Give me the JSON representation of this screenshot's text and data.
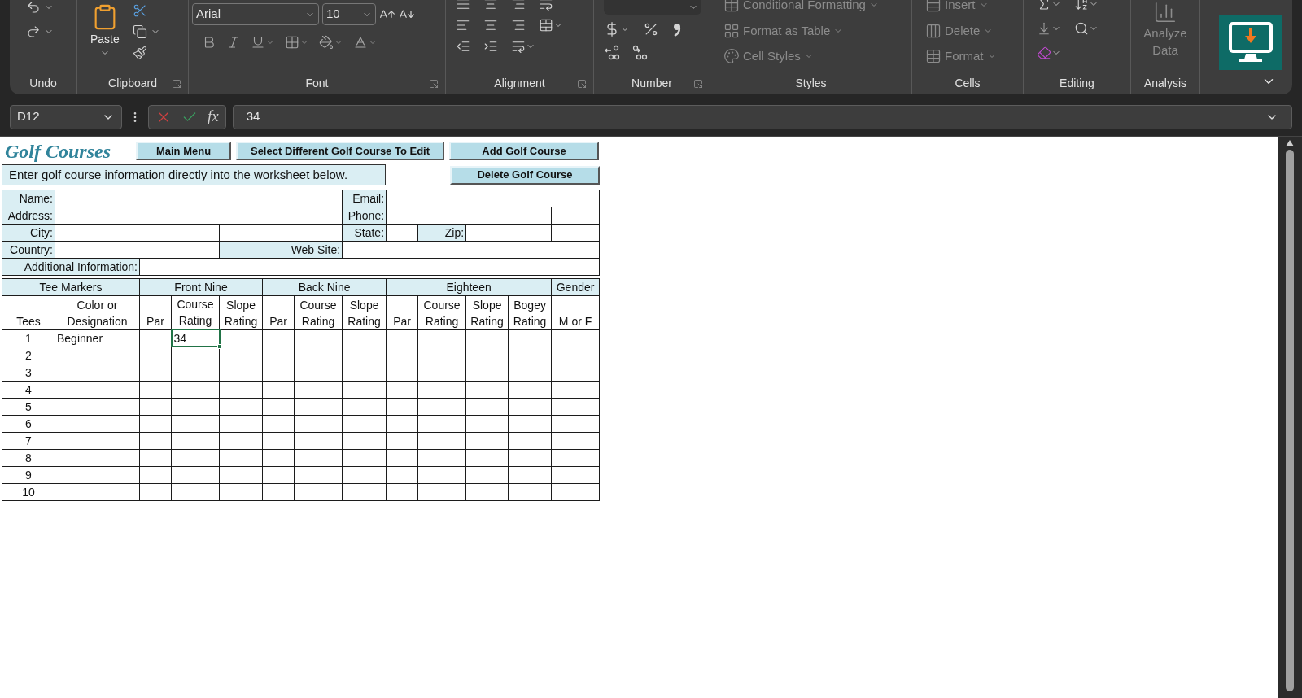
{
  "ribbon": {
    "groups": [
      {
        "kind": "undo",
        "label": "Undo"
      },
      {
        "kind": "clipboard",
        "label": "Clipboard",
        "paste": "Paste"
      },
      {
        "kind": "font",
        "label": "Font",
        "font_name": "Arial",
        "font_size": "10"
      },
      {
        "kind": "alignment",
        "label": "Alignment"
      },
      {
        "kind": "number",
        "label": "Number"
      },
      {
        "kind": "styles",
        "label": "Styles",
        "commands": [
          {
            "label": "Conditional Formatting",
            "disabled": true
          },
          {
            "label": "Format as Table",
            "disabled": true
          },
          {
            "label": "Cell Styles",
            "disabled": true
          }
        ]
      },
      {
        "kind": "cells",
        "label": "Cells",
        "commands": [
          {
            "label": "Insert",
            "disabled": true
          },
          {
            "label": "Delete",
            "disabled": true
          },
          {
            "label": "Format",
            "disabled": true
          }
        ]
      },
      {
        "kind": "editing",
        "label": "Editing"
      },
      {
        "kind": "analysis",
        "label": "Analysis",
        "commands": [
          {
            "label": "Analyze Data",
            "disabled": true
          }
        ]
      }
    ]
  },
  "formula_bar": {
    "name_box": "D12",
    "function_label": "fx",
    "value": "34"
  },
  "sheet": {
    "title": "Golf Courses",
    "buttons": [
      {
        "label": "Main Menu"
      },
      {
        "label": "Select Different Golf Course To Edit"
      },
      {
        "label": "Add Golf Course"
      },
      {
        "label": "Delete Golf Course"
      }
    ],
    "instruction": "Enter golf course information directly into the worksheet below.",
    "info_rows": [
      {
        "labels": [
          "Name:",
          "Email:"
        ]
      },
      {
        "labels": [
          "Address:",
          "Phone:"
        ]
      },
      {
        "labels": [
          "City:",
          "State:",
          "Zip:"
        ]
      },
      {
        "labels": [
          "Country:",
          "Web Site:"
        ]
      },
      {
        "labels": [
          "Additional Information:"
        ]
      }
    ],
    "column_groups": [
      "Tee Markers",
      "Front Nine",
      "Back Nine",
      "Eighteen",
      "Gender"
    ],
    "columns": [
      "Tees",
      "Color or Designation",
      "Par",
      "Course Rating",
      "Slope Rating",
      "Par",
      "Course Rating",
      "Slope Rating",
      "Par",
      "Course Rating",
      "Slope Rating",
      "Bogey Rating",
      "M or F"
    ],
    "rows": [
      {
        "cells": [
          {
            "text": "1",
            "selected": false
          },
          {
            "text": "Beginner",
            "selected": false
          },
          {
            "selected": false
          },
          {
            "text": "34",
            "selected": true
          },
          {
            "selected": false
          },
          {
            "selected": false
          },
          {
            "selected": false
          },
          {
            "selected": false
          },
          {
            "selected": false
          },
          {
            "selected": false
          },
          {
            "selected": false
          },
          {
            "selected": false
          },
          {
            "selected": false
          }
        ]
      },
      {
        "cells": [
          {
            "text": "2",
            "selected": false
          },
          {
            "selected": false
          },
          {
            "selected": false
          },
          {
            "selected": false
          },
          {
            "selected": false
          },
          {
            "selected": false
          },
          {
            "selected": false
          },
          {
            "selected": false
          },
          {
            "selected": false
          },
          {
            "selected": false
          },
          {
            "selected": false
          },
          {
            "selected": false
          },
          {
            "selected": false
          }
        ]
      },
      {
        "cells": [
          {
            "text": "3",
            "selected": false
          },
          {
            "selected": false
          },
          {
            "selected": false
          },
          {
            "selected": false
          },
          {
            "selected": false
          },
          {
            "selected": false
          },
          {
            "selected": false
          },
          {
            "selected": false
          },
          {
            "selected": false
          },
          {
            "selected": false
          },
          {
            "selected": false
          },
          {
            "selected": false
          },
          {
            "selected": false
          }
        ]
      },
      {
        "cells": [
          {
            "text": "4",
            "selected": false
          },
          {
            "selected": false
          },
          {
            "selected": false
          },
          {
            "selected": false
          },
          {
            "selected": false
          },
          {
            "selected": false
          },
          {
            "selected": false
          },
          {
            "selected": false
          },
          {
            "selected": false
          },
          {
            "selected": false
          },
          {
            "selected": false
          },
          {
            "selected": false
          },
          {
            "selected": false
          }
        ]
      },
      {
        "cells": [
          {
            "text": "5",
            "selected": false
          },
          {
            "selected": false
          },
          {
            "selected": false
          },
          {
            "selected": false
          },
          {
            "selected": false
          },
          {
            "selected": false
          },
          {
            "selected": false
          },
          {
            "selected": false
          },
          {
            "selected": false
          },
          {
            "selected": false
          },
          {
            "selected": false
          },
          {
            "selected": false
          },
          {
            "selected": false
          }
        ]
      },
      {
        "cells": [
          {
            "text": "6",
            "selected": false
          },
          {
            "selected": false
          },
          {
            "selected": false
          },
          {
            "selected": false
          },
          {
            "selected": false
          },
          {
            "selected": false
          },
          {
            "selected": false
          },
          {
            "selected": false
          },
          {
            "selected": false
          },
          {
            "selected": false
          },
          {
            "selected": false
          },
          {
            "selected": false
          },
          {
            "selected": false
          }
        ]
      },
      {
        "cells": [
          {
            "text": "7",
            "selected": false
          },
          {
            "selected": false
          },
          {
            "selected": false
          },
          {
            "selected": false
          },
          {
            "selected": false
          },
          {
            "selected": false
          },
          {
            "selected": false
          },
          {
            "selected": false
          },
          {
            "selected": false
          },
          {
            "selected": false
          },
          {
            "selected": false
          },
          {
            "selected": false
          },
          {
            "selected": false
          }
        ]
      },
      {
        "cells": [
          {
            "text": "8",
            "selected": false
          },
          {
            "selected": false
          },
          {
            "selected": false
          },
          {
            "selected": false
          },
          {
            "selected": false
          },
          {
            "selected": false
          },
          {
            "selected": false
          },
          {
            "selected": false
          },
          {
            "selected": false
          },
          {
            "selected": false
          },
          {
            "selected": false
          },
          {
            "selected": false
          },
          {
            "selected": false
          }
        ]
      },
      {
        "cells": [
          {
            "text": "9",
            "selected": false
          },
          {
            "selected": false
          },
          {
            "selected": false
          },
          {
            "selected": false
          },
          {
            "selected": false
          },
          {
            "selected": false
          },
          {
            "selected": false
          },
          {
            "selected": false
          },
          {
            "selected": false
          },
          {
            "selected": false
          },
          {
            "selected": false
          },
          {
            "selected": false
          },
          {
            "selected": false
          }
        ]
      },
      {
        "cells": [
          {
            "text": "10",
            "selected": false
          },
          {
            "selected": false
          },
          {
            "selected": false
          },
          {
            "selected": false
          },
          {
            "selected": false
          },
          {
            "selected": false
          },
          {
            "selected": false
          },
          {
            "selected": false
          },
          {
            "selected": false
          },
          {
            "selected": false
          },
          {
            "selected": false
          },
          {
            "selected": false
          },
          {
            "selected": false
          }
        ]
      }
    ]
  }
}
